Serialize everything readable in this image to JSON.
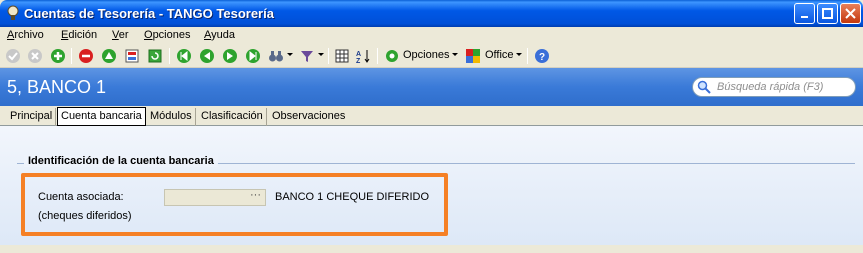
{
  "window": {
    "title": "Cuentas de Tesorería - TANGO Tesorería"
  },
  "menu": [
    {
      "underline": "A",
      "rest": "rchivo"
    },
    {
      "underline": "E",
      "rest": "dición"
    },
    {
      "underline": "V",
      "rest": "er"
    },
    {
      "underline": "O",
      "rest": "pciones"
    },
    {
      "underline": "A",
      "rest": "yuda"
    }
  ],
  "toolbar": {
    "opciones_label": "Opciones",
    "office_label": "Office",
    "icons": [
      "confirm-icon",
      "cancel-icon",
      "add-icon",
      "delete-icon",
      "modify-icon",
      "export-icon",
      "refresh-icon",
      "first-icon",
      "previous-icon",
      "next-icon",
      "last-icon",
      "binoculars-icon",
      "filter-icon",
      "grid-icon",
      "sort-icon",
      "options-icon",
      "office-icon",
      "help-icon"
    ]
  },
  "header": {
    "title": "5, BANCO 1",
    "search_placeholder": "Búsqueda rápida (F3)"
  },
  "tabs": [
    "Principal",
    "Cuenta bancaria",
    "Módulos",
    "Clasificación",
    "Observaciones"
  ],
  "active_tab": "Cuenta bancaria",
  "form": {
    "group_title": "Identificación de la cuenta bancaria",
    "field_label": "Cuenta asociada:",
    "field_sublabel": "(cheques diferidos)",
    "field_value": "",
    "field_button": "···",
    "account_name": "BANCO 1 CHEQUE DIFERIDO"
  },
  "colors": {
    "highlight": "#f58025",
    "header_bg": "#3a7ad8",
    "titlebar": "#0058e6"
  }
}
